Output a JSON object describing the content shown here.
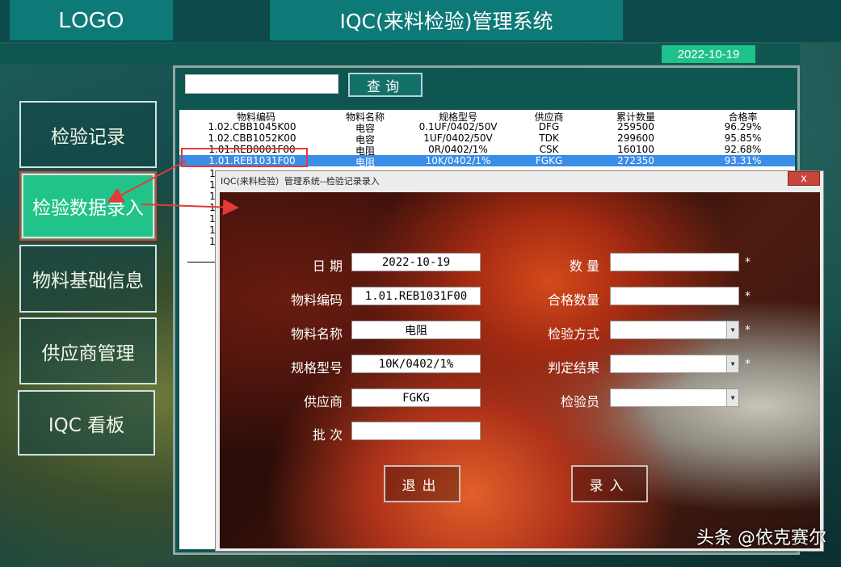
{
  "header": {
    "logo": "LOGO",
    "system_title": "IQC(来料检验)管理系统",
    "date": "2022-10-19"
  },
  "sidebar": {
    "items": [
      {
        "label": "检验记录"
      },
      {
        "label": "检验数据录入"
      },
      {
        "label": "物料基础信息"
      },
      {
        "label": "供应商管理"
      },
      {
        "label": "IQC 看板"
      }
    ]
  },
  "search": {
    "value": "",
    "button": "查询"
  },
  "table": {
    "headers": [
      "物料编码",
      "物料名称",
      "规格型号",
      "供应商",
      "累计数量",
      "合格率"
    ],
    "rows": [
      [
        "1.02.CBB1045K00",
        "电容",
        "0.1UF/0402/50V",
        "DFG",
        "259500",
        "96.29%"
      ],
      [
        "1.02.CBB1052K00",
        "电容",
        "1UF/0402/50V",
        "TDK",
        "299600",
        "95.85%"
      ],
      [
        "1.01.REB0001F00",
        "电阻",
        "0R/0402/1%",
        "CSK",
        "160100",
        "92.68%"
      ],
      [
        "1.01.REB1031F00",
        "电阻",
        "10K/0402/1%",
        "FGKG",
        "272350",
        "93.31%"
      ]
    ],
    "selected_index": 3,
    "partial_row_prefixes": [
      "1",
      "1",
      "1",
      "1",
      "1",
      "1",
      "1"
    ]
  },
  "dialog": {
    "title": "IQC(来料检验）管理系统--检验记录录入",
    "close": "x",
    "left_fields": [
      {
        "label": "日  期",
        "value": "2022-10-19"
      },
      {
        "label": "物料编码",
        "value": "1.01.REB1031F00"
      },
      {
        "label": "物料名称",
        "value": "电阻"
      },
      {
        "label": "规格型号",
        "value": "10K/0402/1%"
      },
      {
        "label": "供应商",
        "value": "FGKG"
      },
      {
        "label": "批  次",
        "value": ""
      }
    ],
    "right_fields": [
      {
        "label": "数  量",
        "value": "",
        "required": "*",
        "type": "text"
      },
      {
        "label": "合格数量",
        "value": "",
        "required": "*",
        "type": "text"
      },
      {
        "label": "检验方式",
        "value": "",
        "required": "*",
        "type": "select"
      },
      {
        "label": "判定结果",
        "value": "",
        "required": "*",
        "type": "select"
      },
      {
        "label": "检验员",
        "value": "",
        "required": "",
        "type": "select"
      }
    ],
    "exit_button": "退出",
    "submit_button": "录入"
  },
  "watermark": "头条 @依克赛尔",
  "colors": {
    "header_teal": "#0e7a78",
    "active_nav": "#22c389",
    "selected_row": "#3b8ee8",
    "annotation_red": "#e23a3a"
  }
}
